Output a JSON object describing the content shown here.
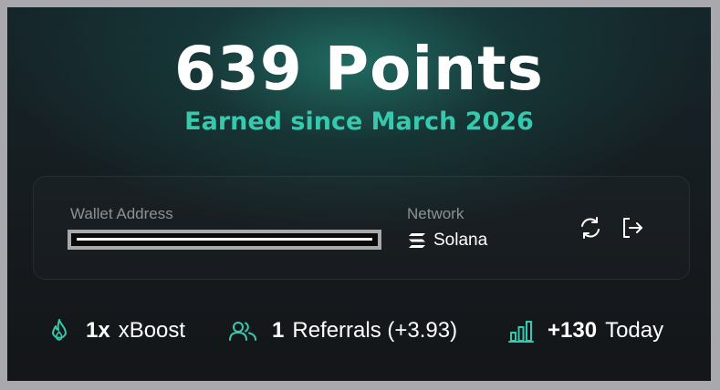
{
  "points": {
    "headline": "639 Points",
    "subtitle": "Earned since March 2026"
  },
  "wallet": {
    "address_label": "Wallet Address",
    "network_label": "Network",
    "network_value": "Solana"
  },
  "actions": {
    "refresh_icon": "refresh-icon",
    "logout_icon": "logout-icon"
  },
  "stats": {
    "boost_value": "1x",
    "boost_label": "xBoost",
    "referrals_value": "1",
    "referrals_label": "Referrals (+3.93)",
    "today_value": "+130",
    "today_label": "Today"
  },
  "colors": {
    "accent": "#36c9ad",
    "background": "#161b1f",
    "frame": "#a9a9ad"
  }
}
